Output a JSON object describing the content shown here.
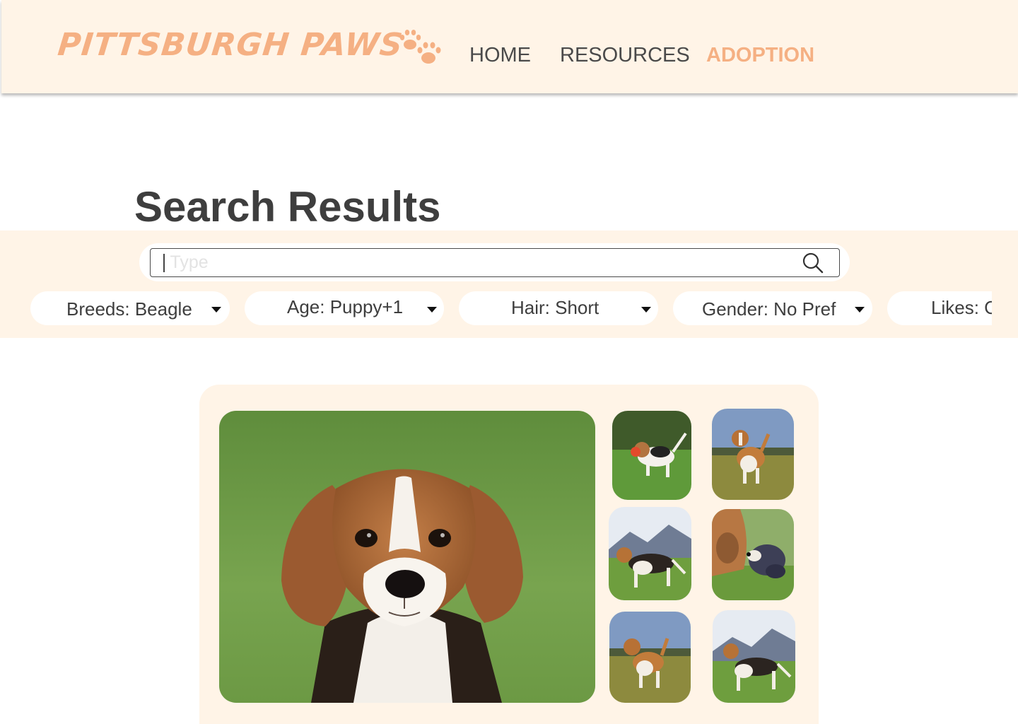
{
  "header": {
    "logo_text": "PITTSBURGH PAWS",
    "logo_icon": "paw-prints-icon",
    "nav": [
      {
        "label": "HOME",
        "active": false
      },
      {
        "label": "RESOURCES",
        "active": false
      },
      {
        "label": "ADOPTION",
        "active": true
      }
    ]
  },
  "page": {
    "title": "Search Results"
  },
  "search": {
    "placeholder": "Type",
    "icon": "search-icon"
  },
  "filters": [
    {
      "label": "Breeds: Beagle"
    },
    {
      "label": "Age: Puppy+1"
    },
    {
      "label": "Hair: Short"
    },
    {
      "label": "Gender: No Pref"
    },
    {
      "label": "Likes: Cats"
    }
  ],
  "gallery": {
    "main_photo": "beagle-puppy-portrait",
    "thumbnails": [
      "beagle-puppy-running-with-ball",
      "beagle-standing-in-field",
      "beagle-standing-mountains",
      "beagle-puppy-nose-to-nose",
      "beagle-standing-in-field-2",
      "beagle-standing-mountains-2"
    ]
  },
  "colors": {
    "accent": "#f5b083",
    "band_background": "#fff4e7",
    "text_dark": "#3e3e3e"
  }
}
